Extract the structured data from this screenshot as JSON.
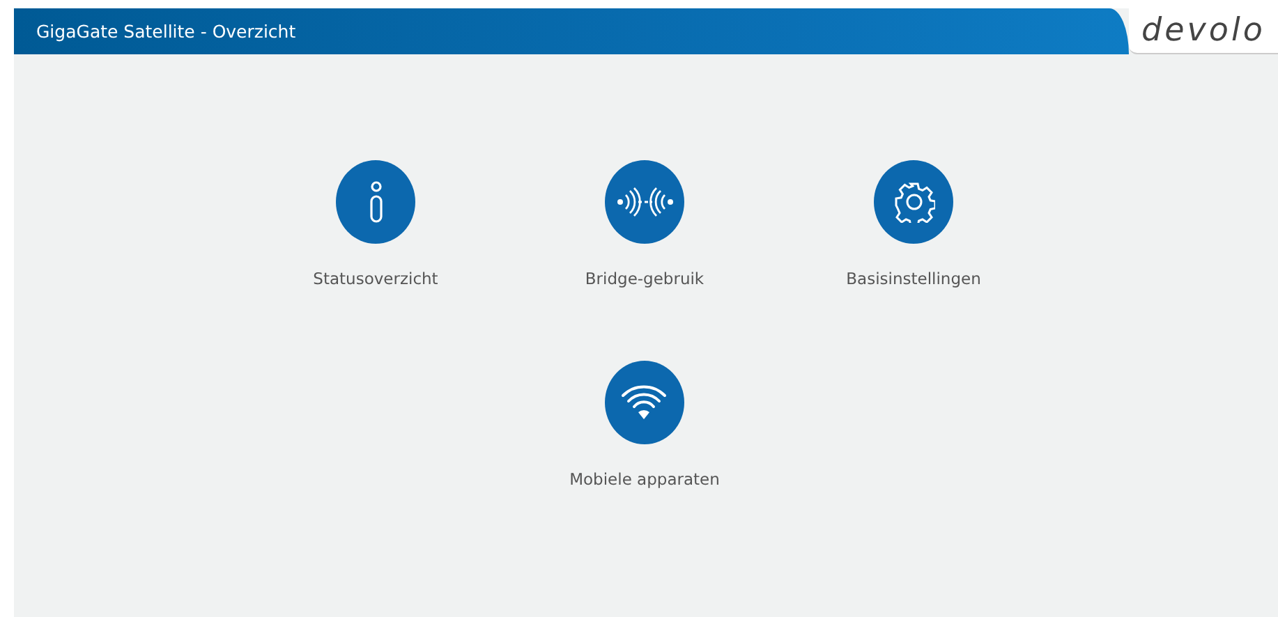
{
  "window": {
    "title": "GigaGate Satellite - Overzicht"
  },
  "logo": "devolo",
  "tiles": [
    {
      "kind": "info",
      "label": "Statusoverzicht"
    },
    {
      "kind": "bridge",
      "label": "Bridge-gebruik"
    },
    {
      "kind": "gear",
      "label": "Basisinstellingen"
    },
    {
      "kind": "wifi",
      "label": "Mobiele apparaten"
    }
  ]
}
